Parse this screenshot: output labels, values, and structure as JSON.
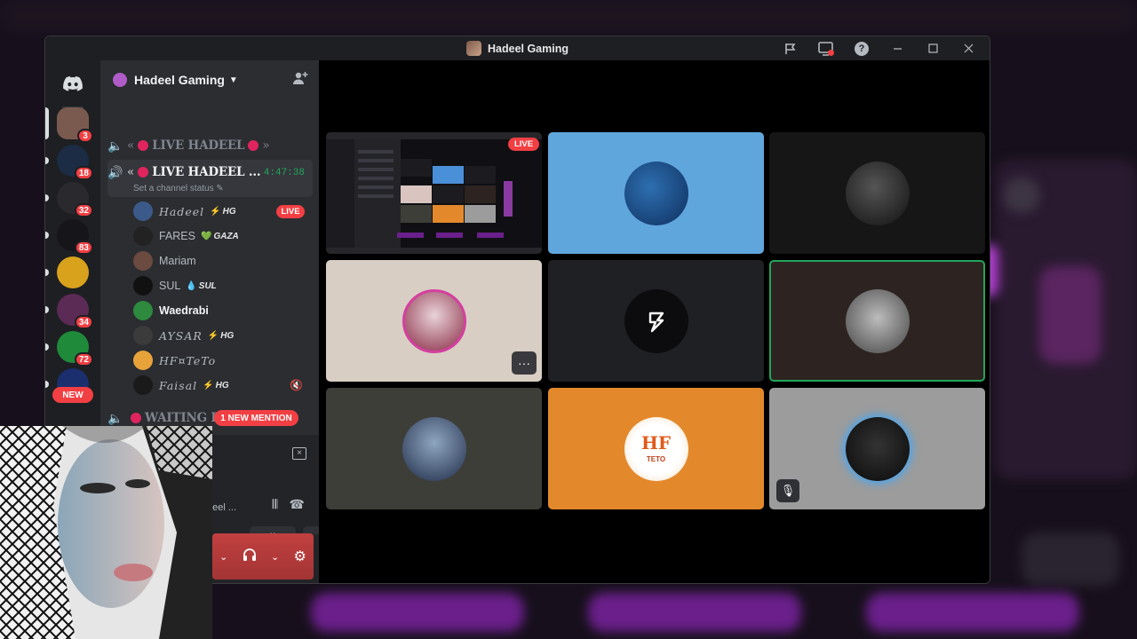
{
  "window": {
    "title": "Hadeel Gaming"
  },
  "titlebar": {
    "icons": [
      "flag-icon",
      "screen-share-icon",
      "help-icon",
      "minimize-icon",
      "maximize-icon",
      "close-icon"
    ],
    "help_glyph": "?"
  },
  "rail": {
    "servers": [
      {
        "name": "server-1",
        "badge": "3",
        "color": "#7a5a4f"
      },
      {
        "name": "server-2",
        "badge": "18",
        "color": "#1b2c44"
      },
      {
        "name": "server-3",
        "badge": "32",
        "color": "#2a2a2e"
      },
      {
        "name": "server-4",
        "badge": "83",
        "color": "#15151a"
      },
      {
        "name": "server-5",
        "badge": "",
        "color": "#d9a21c"
      },
      {
        "name": "server-6",
        "badge": "34",
        "color": "#5b2a55"
      },
      {
        "name": "server-7",
        "badge": "72",
        "color": "#1f8a3a"
      },
      {
        "name": "server-8",
        "badge": "",
        "color": "#1b2f6e"
      }
    ],
    "new_label": "NEW"
  },
  "sidebar": {
    "server_name": "Hadeel Gaming",
    "channels": {
      "top": {
        "prefix": "«",
        "name": "LIVE HADEEL",
        "suffix": "»"
      },
      "active": {
        "prefix": "«",
        "name": "LIVE HADEEL ...",
        "timer": "4:47:38",
        "status": "Set a channel status"
      },
      "waiting": {
        "name": "WAITING ROOM"
      }
    },
    "members": [
      {
        "name": "Hadeel",
        "tag": "HG",
        "tag_icon": "⚡",
        "live": "LIVE",
        "style": "serif",
        "color": "#3b5a8a"
      },
      {
        "name": "FARES",
        "tag": "GAZA",
        "tag_icon": "💚",
        "live": "",
        "style": "plain",
        "color": "#222"
      },
      {
        "name": "Mariam",
        "tag": "",
        "tag_icon": "",
        "live": "",
        "style": "plain",
        "color": "#6b4a40"
      },
      {
        "name": "SUL",
        "tag": "SUL",
        "tag_icon": "💧",
        "live": "",
        "style": "plain",
        "color": "#111"
      },
      {
        "name": "Waedrabi",
        "tag": "",
        "tag_icon": "",
        "live": "",
        "style": "bold",
        "color": "#2d8a3e"
      },
      {
        "name": "AYSAR",
        "tag": "HG",
        "tag_icon": "⚡",
        "live": "",
        "style": "serif",
        "color": "#3b3b3b"
      },
      {
        "name": "HF¤TeTo",
        "tag": "",
        "tag_icon": "",
        "live": "",
        "style": "serif",
        "color": "#e8a23a"
      },
      {
        "name": "Faisal",
        "tag": "HG",
        "tag_icon": "⚡",
        "live": "",
        "style": "serif",
        "color": "#1a1a1a"
      }
    ],
    "mention_label": "1 NEW MENTION",
    "voice_sub": "deel ..."
  },
  "grid": {
    "live_label": "LIVE",
    "more_glyph": "···",
    "tiles": [
      {
        "name": "tile-stream",
        "bg": "#111"
      },
      {
        "name": "tile-bird",
        "bg": "#5fa6dc"
      },
      {
        "name": "tile-portrait-bw",
        "bg": "#161616"
      },
      {
        "name": "tile-pink",
        "bg": "#d8cec3"
      },
      {
        "name": "tile-logo",
        "bg": "#1f2023"
      },
      {
        "name": "tile-car",
        "bg": "#2d2421"
      },
      {
        "name": "tile-man-jacket",
        "bg": "#3e3e39"
      },
      {
        "name": "tile-teto",
        "bg": "#e3892c"
      },
      {
        "name": "tile-blue-glow",
        "bg": "#9c9c9c"
      }
    ],
    "teto_text": "HF",
    "teto_sub": "TETO"
  }
}
